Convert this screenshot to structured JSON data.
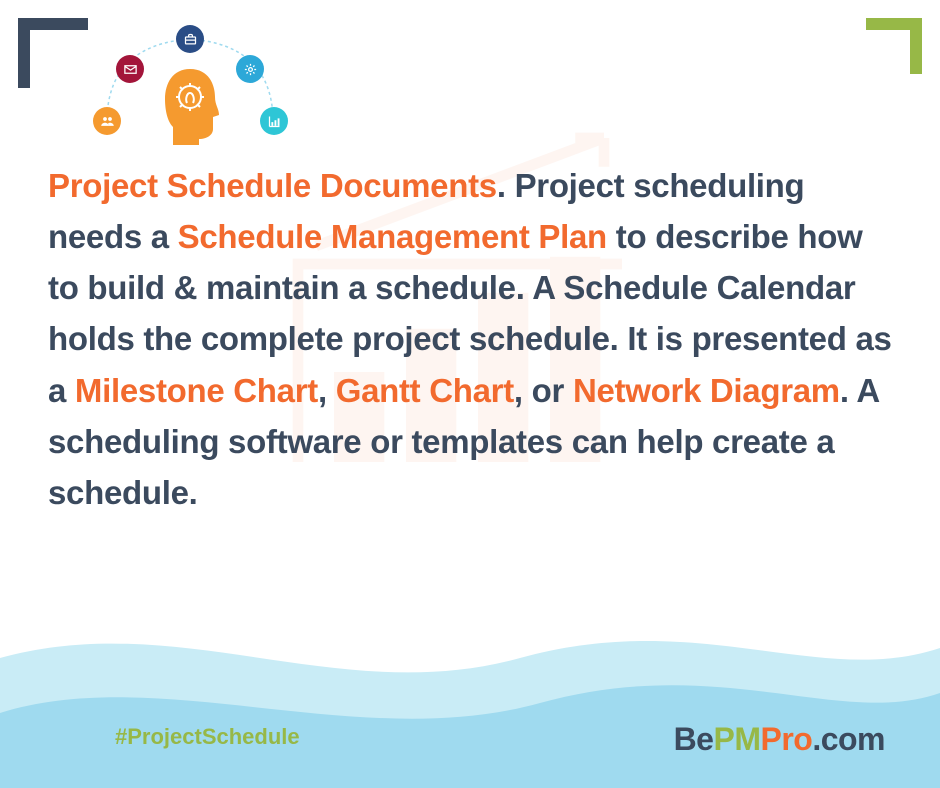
{
  "text": {
    "s1": "Project Schedule Documents",
    "s2": ". Project scheduling needs a ",
    "s3": "Schedule Management Plan",
    "s4": " to describe how to build & maintain a schedule. A Schedule Calendar holds the complete project schedule. It is presented as a ",
    "s5": "Milestone Chart",
    "s6": ", ",
    "s7": "Gantt Chart",
    "s8": ", or ",
    "s9": "Network Diagram",
    "s10": ". A scheduling software or templates can help create a schedule."
  },
  "hashtag": "#ProjectSchedule",
  "logo": {
    "p1": "Be",
    "p2": "PM",
    "p3": "Pro",
    "p4": ".com"
  },
  "icons": {
    "people": "people-icon",
    "mail": "mail-icon",
    "briefcase": "briefcase-icon",
    "gear": "gear-icon",
    "chart": "chart-icon",
    "head": "idea-head-icon"
  }
}
